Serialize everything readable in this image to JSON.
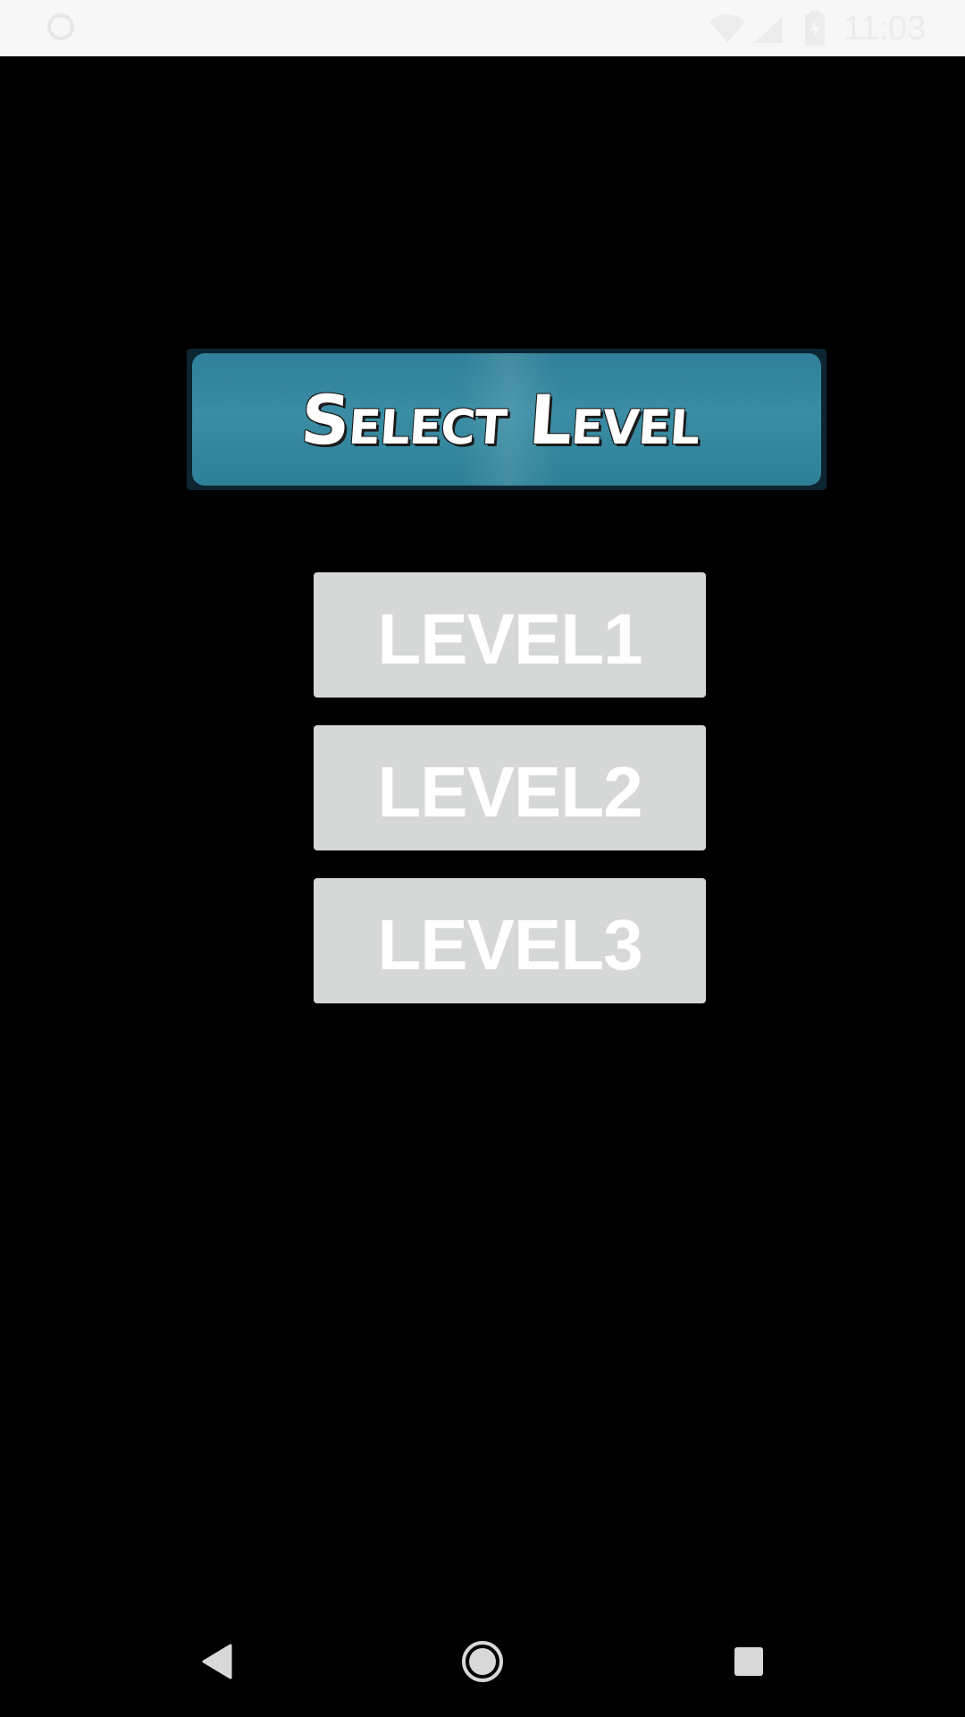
{
  "status_bar": {
    "time": "11:03",
    "icons": [
      "sync-icon",
      "wifi-icon",
      "signal-icon",
      "battery-icon"
    ]
  },
  "title_banner": {
    "text": "Select Level"
  },
  "levels": [
    {
      "label": "LEVEL1"
    },
    {
      "label": "LEVEL2"
    },
    {
      "label": "LEVEL3"
    }
  ],
  "nav_bar": {
    "icons": [
      "back-icon",
      "home-icon",
      "recents-icon"
    ]
  },
  "colors": {
    "background": "#000000",
    "button_bg": "#d6d7d7",
    "button_text": "#ffffff",
    "banner_teal": "#3a8da4"
  }
}
